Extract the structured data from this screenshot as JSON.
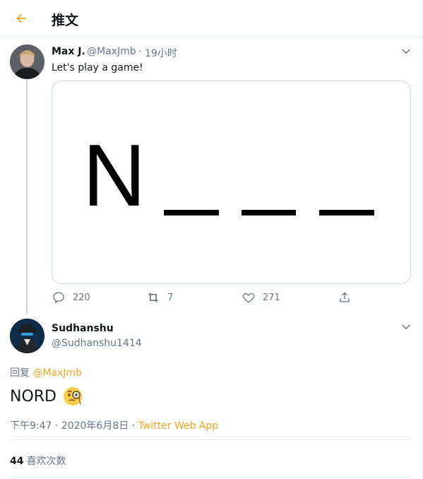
{
  "header": {
    "title": "推文",
    "back_icon": "arrow-left-icon",
    "accent": "#f5a623"
  },
  "tweet1": {
    "name": "Max J.",
    "handle": "@MaxJmb",
    "separator": "·",
    "time": "19小时",
    "text": "Let's play a game!",
    "media": {
      "letter": "N",
      "blanks": 3
    },
    "actions": {
      "reply_count": "220",
      "retweet_count": "7",
      "like_count": "271"
    }
  },
  "tweet2": {
    "name": "Sudhanshu",
    "handle": "@Sudhanshu1414",
    "reply_prefix": "回复",
    "reply_mention": "@MaxJmb",
    "text": "NORD",
    "emoji": "face-with-monocle",
    "timestamp": "下午9:47 · 2020年6月8日 ·",
    "source": "Twitter Web App",
    "likes_count": "44",
    "likes_label": "喜欢次数"
  }
}
